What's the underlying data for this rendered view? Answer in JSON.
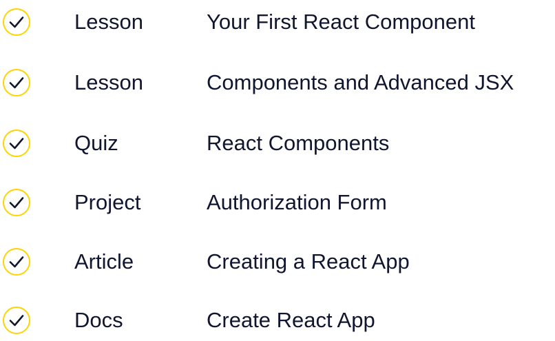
{
  "status_color": "#ffd300",
  "check_color": "#10162f",
  "items": [
    {
      "type": "Lesson",
      "title": "Your First React Component",
      "completed": true,
      "icon": "check-circle-icon"
    },
    {
      "type": "Lesson",
      "title": "Components and Advanced JSX",
      "completed": true,
      "icon": "check-circle-icon"
    },
    {
      "type": "Quiz",
      "title": "React Components",
      "completed": true,
      "icon": "check-circle-icon"
    },
    {
      "type": "Project",
      "title": "Authorization Form",
      "completed": true,
      "icon": "check-circle-icon"
    },
    {
      "type": "Article",
      "title": "Creating a React App",
      "completed": true,
      "icon": "check-circle-icon"
    },
    {
      "type": "Docs",
      "title": "Create React App",
      "completed": true,
      "icon": "check-circle-icon"
    }
  ]
}
